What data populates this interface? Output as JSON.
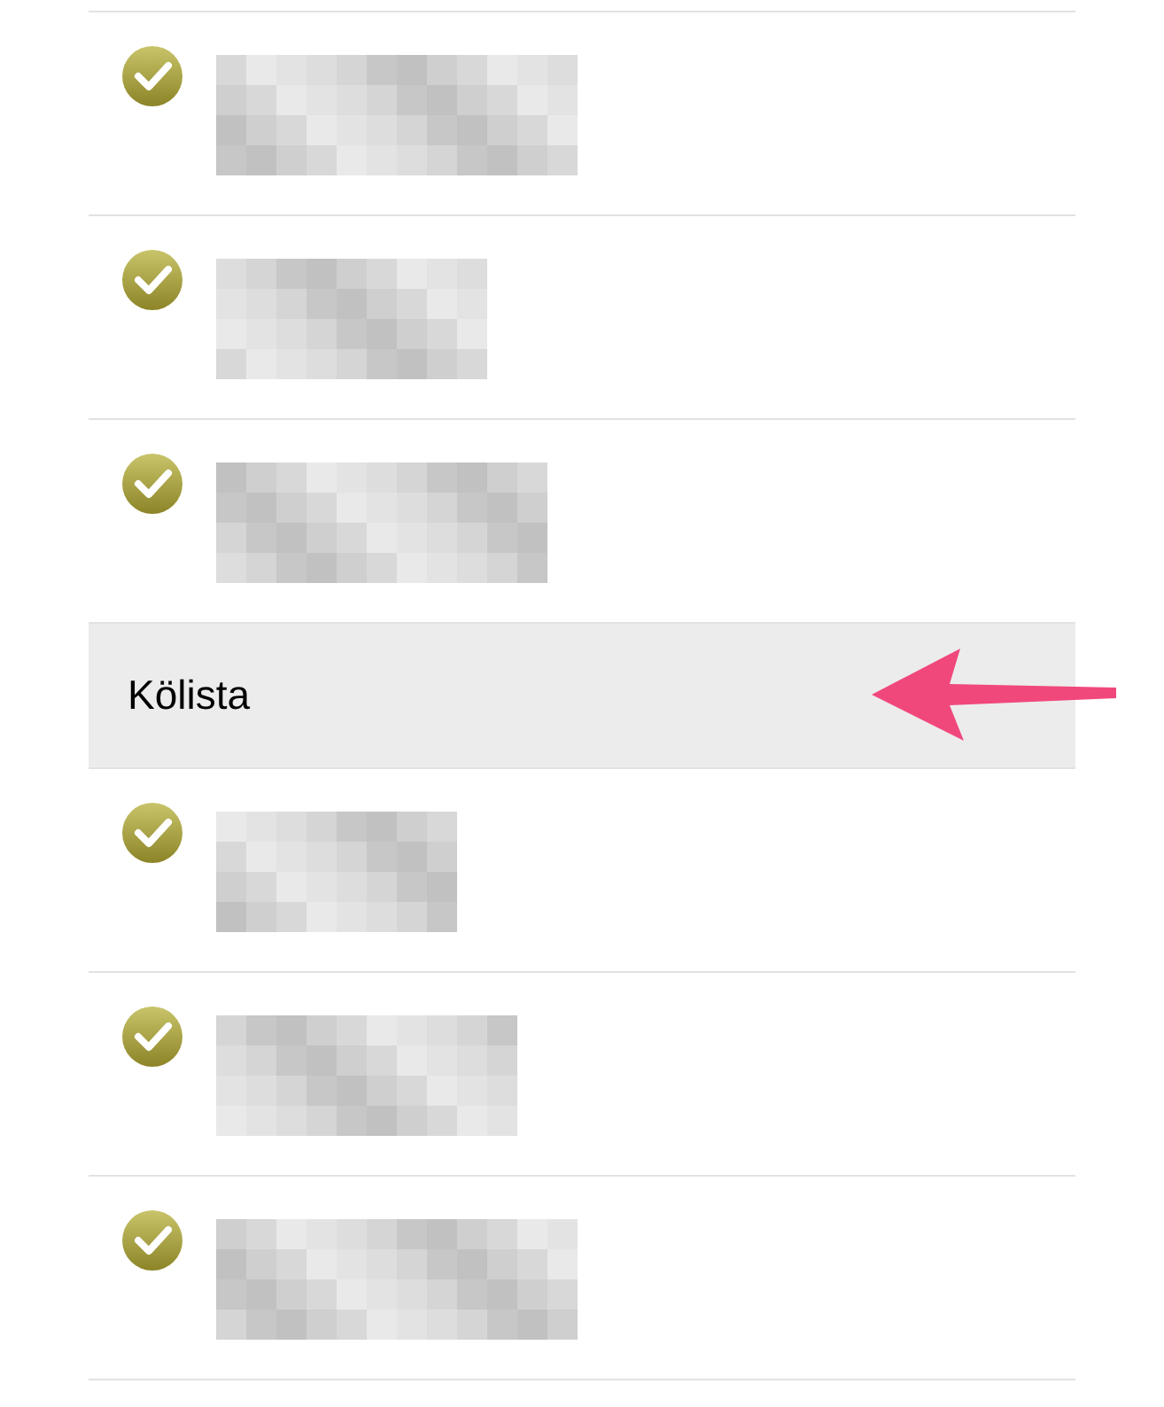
{
  "items_before": [
    {
      "checked": true
    },
    {
      "checked": true
    },
    {
      "checked": true
    }
  ],
  "section": {
    "title": "Kölista"
  },
  "items_after": [
    {
      "checked": true
    },
    {
      "checked": true
    },
    {
      "checked": true
    }
  ]
}
